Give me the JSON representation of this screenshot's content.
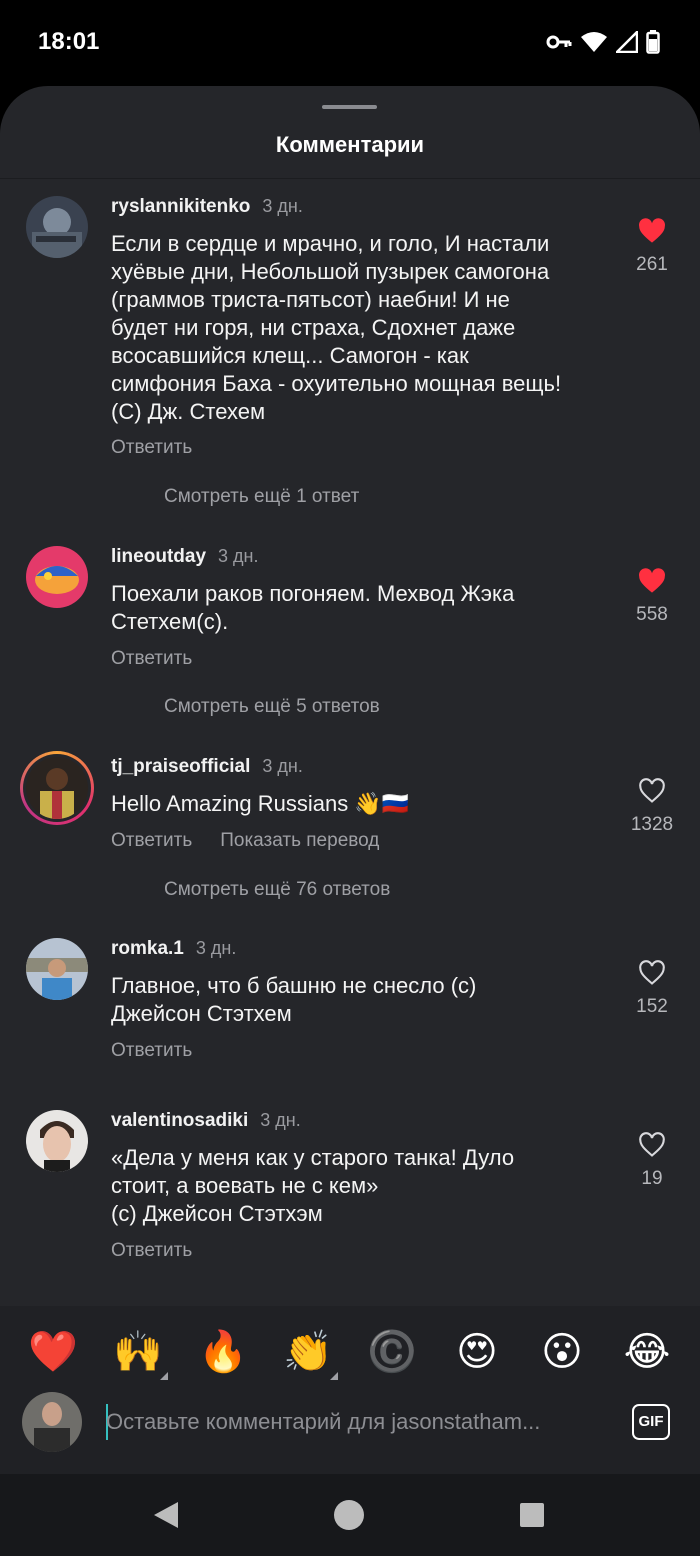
{
  "status_bar": {
    "time": "18:01"
  },
  "sheet": {
    "title": "Комментарии"
  },
  "comments": [
    {
      "username": "ryslannikitenko",
      "age": "3 дн.",
      "text": "Если в сердце и мрачно, и голо, И настали\nхуёвые дни, Небольшой пузырек самогона\n(граммов триста-пятьсот) наебни! И не\nбудет ни горя, ни страха, Сдохнет даже\nвсосавшийся клещ... Самогон - как\nсимфония Баха - охуительно мощная вещь!\n(C) Дж. Стехем",
      "reply_label": "Ответить",
      "likes": "261",
      "liked": true,
      "more_replies": "Смотреть ещё 1 ответ"
    },
    {
      "username": "lineoutday",
      "age": "3 дн.",
      "text": "Поехали раков погоняем. Мехвод Жэка\nСтетхем(с).",
      "reply_label": "Ответить",
      "likes": "558",
      "liked": true,
      "more_replies": "Смотреть ещё 5 ответов"
    },
    {
      "username": "tj_praiseofficial",
      "age": "3 дн.",
      "text": "Hello Amazing Russians 👋🇷🇺",
      "reply_label": "Ответить",
      "translate_label": "Показать перевод",
      "likes": "1328",
      "liked": false,
      "more_replies": "Смотреть ещё 76 ответов"
    },
    {
      "username": "romka.1",
      "age": "3 дн.",
      "text": "Главное, что б башню не снесло (с)\nДжейсон Стэтхем",
      "reply_label": "Ответить",
      "likes": "152",
      "liked": false
    },
    {
      "username": "valentinosadiki",
      "age": "3 дн.",
      "text": "«Дела у меня как у старого танка! Дуло\nстоит, а воевать не с кем»\n(с) Джейсон Стэтхэм",
      "reply_label": "Ответить",
      "likes": "19",
      "liked": false
    }
  ],
  "emoji_bar": [
    "❤️",
    "🙌",
    "🔥",
    "👏",
    "©️",
    "😍",
    "😮",
    "😂"
  ],
  "composer": {
    "placeholder": "Оставьте комментарий для jasonstatham...",
    "gif_label": "GIF"
  },
  "colors": {
    "like_red": "#ff3040",
    "sheet_bg": "#25262a",
    "cursor": "#35c0c0"
  }
}
